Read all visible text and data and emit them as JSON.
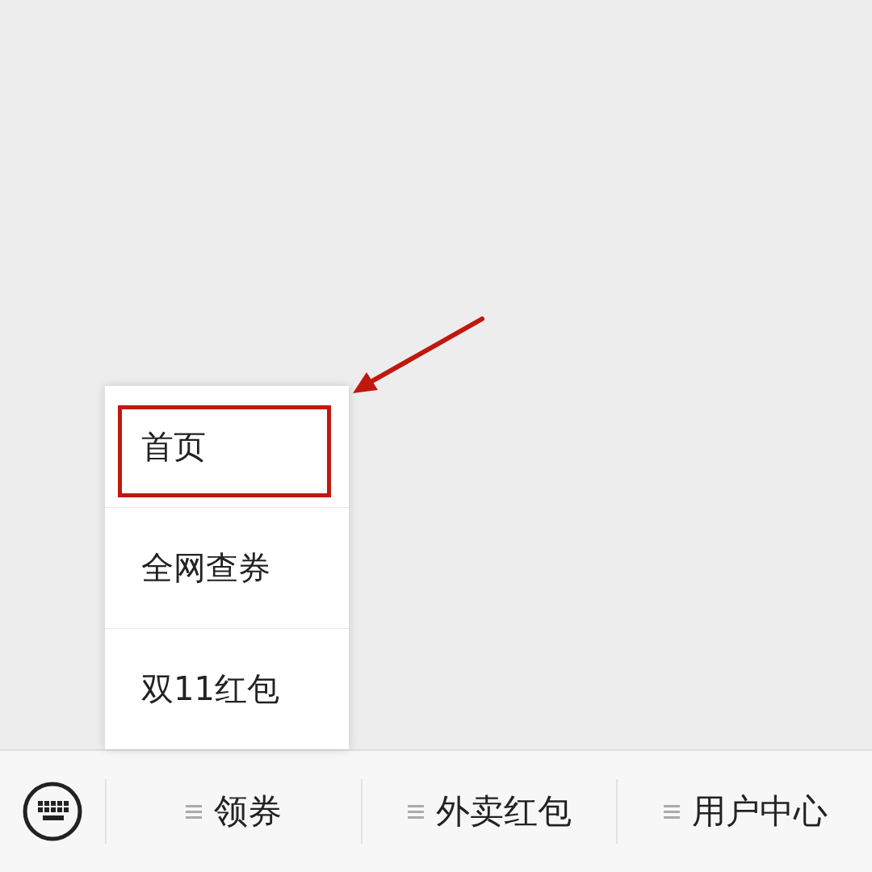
{
  "popup_menu": {
    "items": [
      {
        "label": "首页",
        "highlighted": true
      },
      {
        "label": "全网查券",
        "highlighted": false
      },
      {
        "label": "双11红包",
        "highlighted": false
      }
    ]
  },
  "bottom_menu": {
    "items": [
      {
        "label": "领券"
      },
      {
        "label": "外卖红包"
      },
      {
        "label": "用户中心"
      }
    ]
  }
}
